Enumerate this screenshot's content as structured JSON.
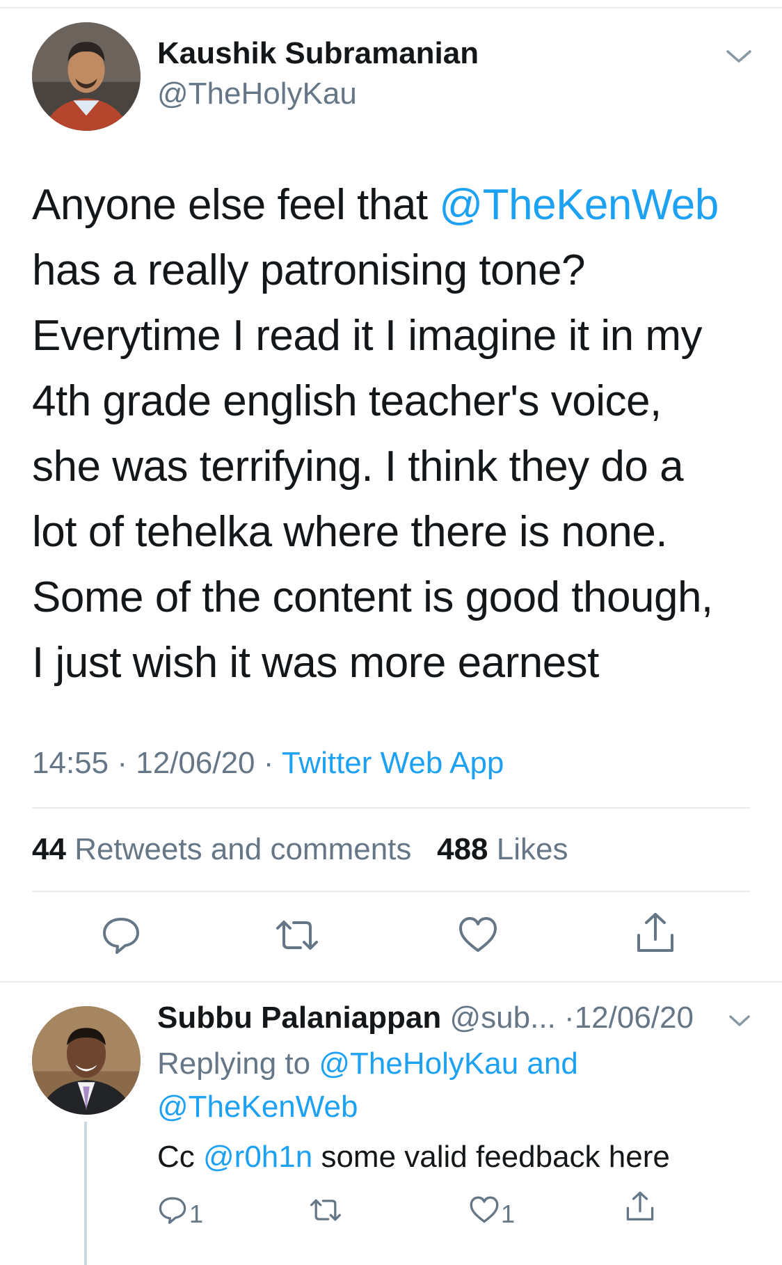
{
  "tweet": {
    "author": {
      "name": "Kaushik Subramanian",
      "handle": "@TheHolyKau",
      "avatar_icon": "avatar-photo"
    },
    "text_lines": [
      {
        "plain": "Anyone else feel that ",
        "mention": "@TheKenWeb"
      },
      {
        "plain": "has a really patronising tone?"
      },
      {
        "plain": "Everytime I read it I imagine it in my"
      },
      {
        "plain": "4th grade english teacher's voice,"
      },
      {
        "plain": "she was terrifying. I think they do a"
      },
      {
        "plain": "lot of tehelka where there is none."
      },
      {
        "plain": "Some of the content is good though,"
      },
      {
        "plain": "I just wish it was more earnest"
      }
    ],
    "time": "14:55",
    "date": "12/06/20",
    "separator": "·",
    "source": "Twitter Web App",
    "retweets_count": "44",
    "retweets_label": "Retweets and comments",
    "likes_count": "488",
    "likes_label": "Likes",
    "actions": [
      "reply-icon",
      "retweet-icon",
      "like-icon",
      "share-icon"
    ]
  },
  "reply": {
    "author": {
      "name": "Subbu Palaniappan",
      "handle": "@sub...",
      "avatar_icon": "avatar-photo"
    },
    "separator": "·",
    "date": "12/06/20",
    "replying_prefix": "Replying to",
    "replying_user1": "@TheHolyKau",
    "replying_and": "and",
    "replying_user2": "@TheKenWeb",
    "text_prefix": "Cc",
    "text_mention": "@r0h1n",
    "text_rest": " some valid feedback here",
    "reply_count": "1",
    "like_count": "1"
  },
  "colors": {
    "link": "#1da1f2",
    "secondary": "#657786",
    "text": "#14171a",
    "divider": "#e6ecf0"
  }
}
